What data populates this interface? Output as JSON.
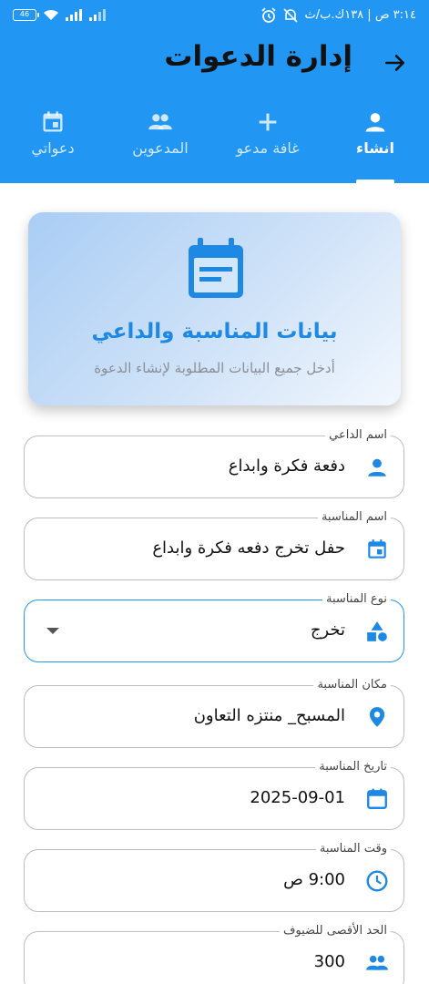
{
  "status_bar": {
    "time": "٣:١٤ ص | ١٣٨ك.ب/ث",
    "battery": "46"
  },
  "header": {
    "title": "إدارة الدعوات"
  },
  "tabs": [
    {
      "label": "انشاء",
      "icon": "person-icon",
      "active": true
    },
    {
      "label": "غافة مدعو",
      "icon": "plus-icon",
      "active": false
    },
    {
      "label": "المدعوين",
      "icon": "people-icon",
      "active": false
    },
    {
      "label": "دعواتي",
      "icon": "calendar-icon",
      "active": false
    }
  ],
  "hero": {
    "title": "بيانات المناسبة والداعي",
    "subtitle": "أدخل جميع البيانات المطلوبة لإنشاء الدعوة"
  },
  "form": {
    "inviter_name": {
      "label": "اسم الداعي",
      "value": "دفعة فكرة وابداع"
    },
    "event_name": {
      "label": "اسم المناسبة",
      "value": "حفل تخرج دفعه فكرة وابداع"
    },
    "event_type": {
      "label": "نوع المناسبة",
      "value": "تخرج"
    },
    "event_location": {
      "label": "مكان المناسبة",
      "value": "المسبح_ منتزه التعاون"
    },
    "event_date": {
      "label": "تاريخ المناسبة",
      "value": "2025-09-01"
    },
    "event_time": {
      "label": "وقت المناسبة",
      "value": "9:00 ص"
    },
    "max_guests": {
      "label": "الحد الأقصى للضيوف",
      "value": "300"
    }
  },
  "colors": {
    "primary": "#2196F3",
    "accent_text": "#1E88E5",
    "icon": "#1E88E5"
  }
}
